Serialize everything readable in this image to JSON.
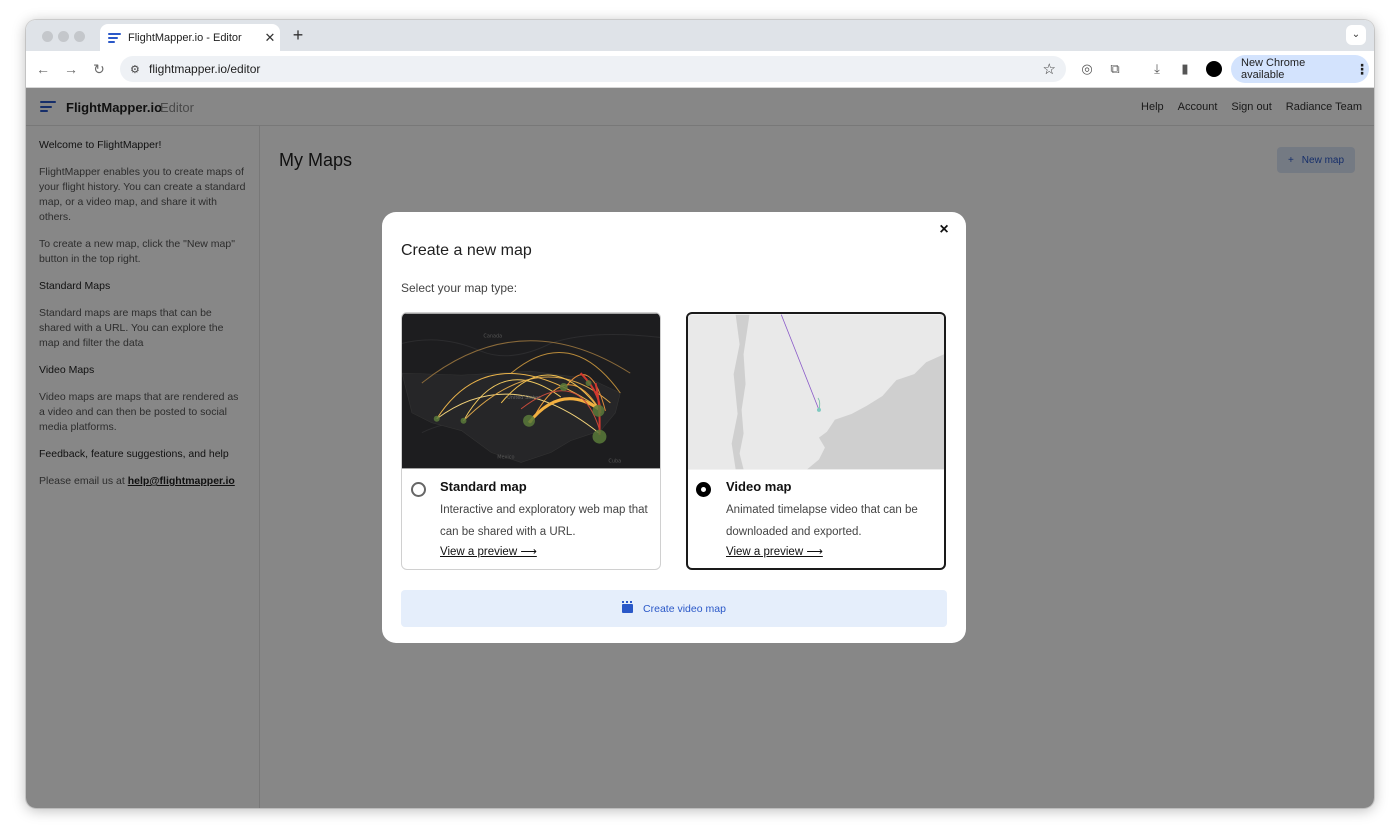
{
  "browser": {
    "tab_title": "FlightMapper.io - Editor",
    "tab_close": "✕",
    "new_tab": "+",
    "tab_search": "⌄",
    "url": "flightmapper.io/editor",
    "update_label": "New Chrome available",
    "update_menu": "⋮"
  },
  "app": {
    "brand": "FlightMapper.io",
    "brand_sub": "Editor",
    "nav": [
      "Help",
      "Account",
      "Sign out",
      "Radiance Team"
    ]
  },
  "sidebar": {
    "welcome_title": "Welcome to FlightMapper!",
    "intro": "FlightMapper enables you to create maps of your flight history. You can create a standard map, or a video map, and share it with others.",
    "create_hint": "To create a new map, click the \"New map\" button in the top right.",
    "standard_title": "Standard Maps",
    "standard_text": "Standard maps are maps that can be shared with a URL. You can explore the map and filter the data",
    "video_title": "Video Maps",
    "video_text": "Video maps are maps that are rendered as a video and can then be posted to social media platforms.",
    "feedback_title": "Feedback, feature suggestions, and help",
    "email_prefix": "Please email us at",
    "email": "help@flightmapper.io"
  },
  "main": {
    "title": "My Maps",
    "new_map_plus": "+",
    "new_map_label": "New map"
  },
  "modal": {
    "close": "×",
    "title": "Create a new map",
    "subtitle": "Select your map type:",
    "options": [
      {
        "title": "Standard map",
        "description": "Interactive and exploratory web map that can be shared with a URL.",
        "link": "View a preview ⟶",
        "selected": false,
        "map_labels": [
          "Canada",
          "United States",
          "Mexico",
          "Cuba"
        ]
      },
      {
        "title": "Video map",
        "description": "Animated timelapse video that can be downloaded and exported.",
        "link": "View a preview ⟶",
        "selected": true
      }
    ],
    "create_label": "Create video map"
  },
  "colors": {
    "accent": "#2a58c8",
    "overlay": "rgba(0,0,0,0.47)",
    "dark_map": "#1d1d1f",
    "light_map": "#cfcfcf"
  }
}
